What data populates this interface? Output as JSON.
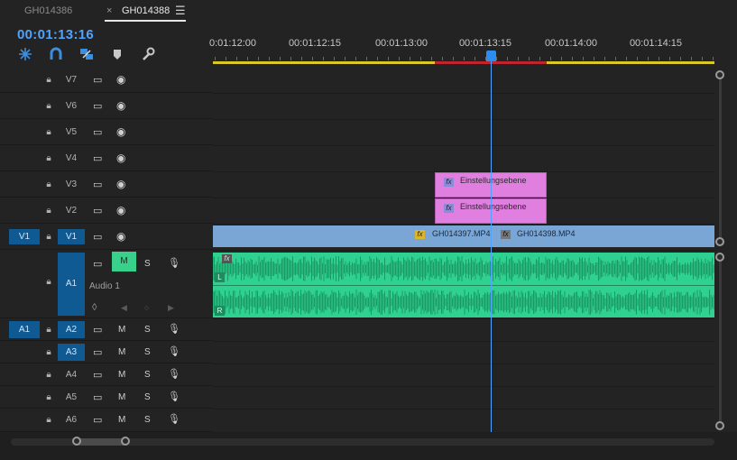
{
  "tabs": [
    {
      "label": "GH014386",
      "active": false
    },
    {
      "label": "GH014388",
      "active": true,
      "close_glyph": "×",
      "menu_glyph": "☰"
    }
  ],
  "timecode": "00:01:13:16",
  "tools": [
    "snap-icon",
    "magnet-icon",
    "linked-selection-icon",
    "marker-icon",
    "wrench-icon"
  ],
  "ruler": {
    "labels": [
      "0:01:12:00",
      "00:01:12:15",
      "00:01:13:00",
      "00:01:13:15",
      "00:01:14:00",
      "00:01:14:15"
    ]
  },
  "video_tracks": [
    {
      "name": "V7"
    },
    {
      "name": "V6"
    },
    {
      "name": "V5"
    },
    {
      "name": "V4"
    },
    {
      "name": "V3"
    },
    {
      "name": "V2"
    },
    {
      "name": "V1",
      "source": "V1",
      "targeted": true
    }
  ],
  "audio_tracks": [
    {
      "name": "A1",
      "label": "Audio 1",
      "source": "",
      "mute_active": true
    },
    {
      "name": "A2",
      "source": "A1"
    },
    {
      "name": "A3"
    },
    {
      "name": "A4"
    },
    {
      "name": "A5"
    },
    {
      "name": "A6"
    }
  ],
  "buttons": {
    "mute": "M",
    "solo": "S"
  },
  "clips": {
    "v3": {
      "label": "Einstellungsebene",
      "fx": "fx"
    },
    "v2": {
      "label": "Einstellungsebene",
      "fx": "fx"
    },
    "v1a": {
      "label": "GH014397.MP4",
      "fx": "fx"
    },
    "v1b": {
      "label": "GH014398.MP4",
      "fx": "fx"
    },
    "audio": {
      "fx": "fx",
      "left": "L",
      "right": "R"
    }
  },
  "colors": {
    "accent": "#4ea4ff",
    "adjustment_clip": "#e17fe0",
    "video_clip": "#7aa6d6",
    "audio_clip": "#2fd190",
    "work_area": "#d9c828",
    "render_needed": "#c0252f"
  }
}
